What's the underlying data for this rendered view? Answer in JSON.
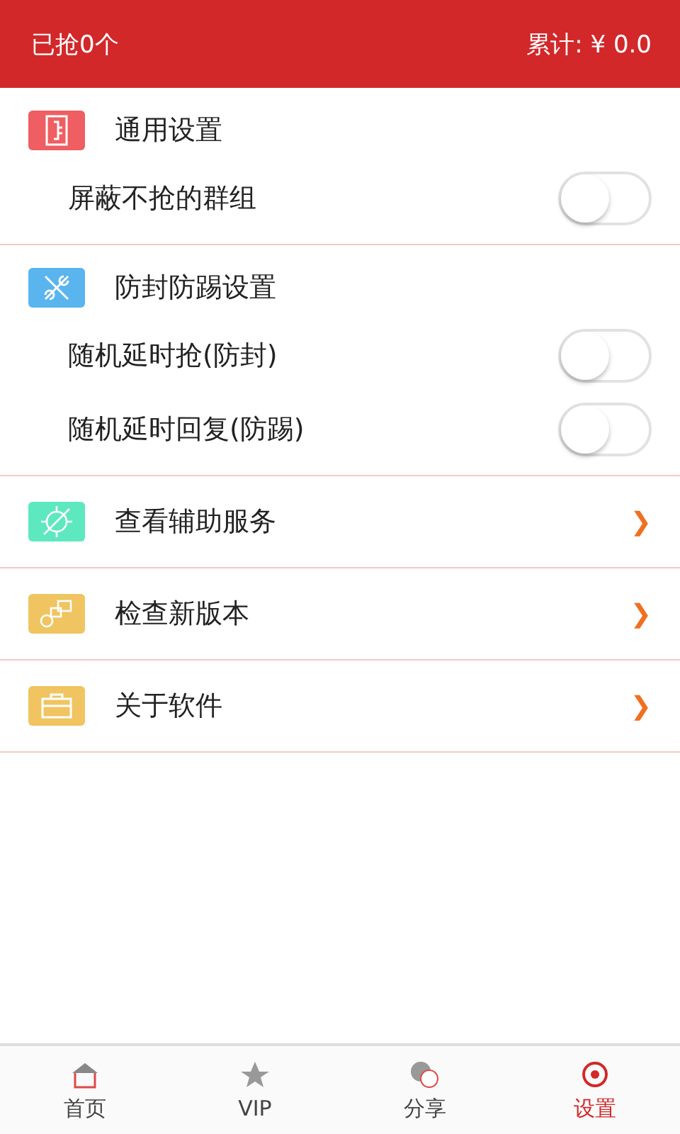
{
  "header": {
    "title": "已抢0个",
    "total": "累计: ¥ 0.0"
  },
  "sections": [
    {
      "kind": "group",
      "color": "#ee5e62",
      "title": "通用设置",
      "toggles": [
        {
          "label": "屏蔽不抢的群组",
          "on": false
        }
      ]
    },
    {
      "kind": "group",
      "color": "#5ab4ee",
      "title": "防封防踢设置",
      "toggles": [
        {
          "label": "随机延时抢(防封)",
          "on": false
        },
        {
          "label": "随机延时回复(防踢)",
          "on": false
        }
      ]
    },
    {
      "kind": "link",
      "color": "#5ee8c0",
      "title": "查看辅助服务",
      "chevron": "❯"
    },
    {
      "kind": "link",
      "color": "#f0c460",
      "title": "检查新版本",
      "chevron": "❯"
    },
    {
      "kind": "link",
      "color": "#f0c460",
      "title": "关于软件",
      "chevron": "❯"
    }
  ],
  "tabs": [
    {
      "label": "首页",
      "selected": false
    },
    {
      "label": "VIP",
      "selected": false
    },
    {
      "label": "分享",
      "selected": false
    },
    {
      "label": "设置",
      "selected": true
    }
  ]
}
